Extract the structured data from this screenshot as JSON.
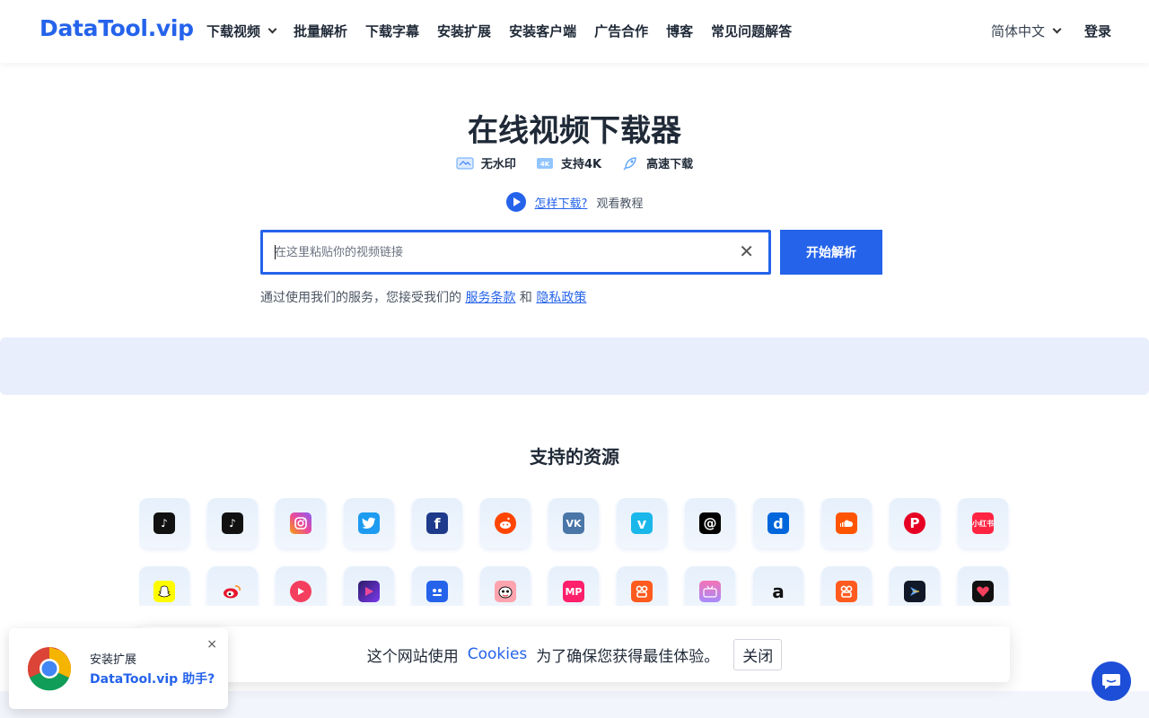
{
  "header": {
    "logo": "DataTool.vip",
    "nav": [
      {
        "label": "下载视频",
        "dropdown": true
      },
      {
        "label": "批量解析"
      },
      {
        "label": "下载字幕"
      },
      {
        "label": "安装扩展"
      },
      {
        "label": "安装客户端"
      },
      {
        "label": "广告合作"
      },
      {
        "label": "博客"
      },
      {
        "label": "常见问题解答"
      }
    ],
    "language": "简体中文",
    "login": "登录"
  },
  "hero": {
    "title": "在线视频下载器",
    "features": [
      "无水印",
      "支持4K",
      "高速下载"
    ],
    "howto_link": "怎样下载?",
    "howto_text": "观看教程"
  },
  "search": {
    "placeholder": "在这里粘贴你的视频链接",
    "button": "开始解析"
  },
  "terms": {
    "prefix": "通过使用我们的服务，您接受我们的",
    "service_link": "服务条款",
    "and": "和",
    "privacy_link": "隐私政策"
  },
  "sources": {
    "title": "支持的资源",
    "row1": [
      "tiktok-icon",
      "douyin-icon",
      "instagram-icon",
      "twitter-icon",
      "facebook-icon",
      "reddit-icon",
      "vk-icon",
      "vimeo-icon",
      "threads-icon",
      "dailymotion-icon",
      "soundcloud-icon",
      "pinterest-icon",
      "xiaohongshu-icon"
    ],
    "row2": [
      "snapchat-icon",
      "weibo-icon",
      "pipixia-icon",
      "haokan-icon",
      "qichezhijia-icon",
      "zuiyou-icon",
      "meipai-icon",
      "kuaishou-icon",
      "bilibili-icon",
      "amazon-icon",
      "kuaishou-lite-icon",
      "xigua-icon",
      "weishi-icon"
    ],
    "xiaohongshu_label": "小红书"
  },
  "cookie": {
    "prefix": "这个网站使用",
    "link": "Cookies",
    "suffix": "为了确保您获得最佳体验。",
    "close": "关闭"
  },
  "extension_popup": {
    "line1": "安装扩展",
    "line2": "DataTool.vip 助手?",
    "close": "×"
  },
  "colors": {
    "accent": "#2563eb",
    "banner": "#e8eefc"
  }
}
